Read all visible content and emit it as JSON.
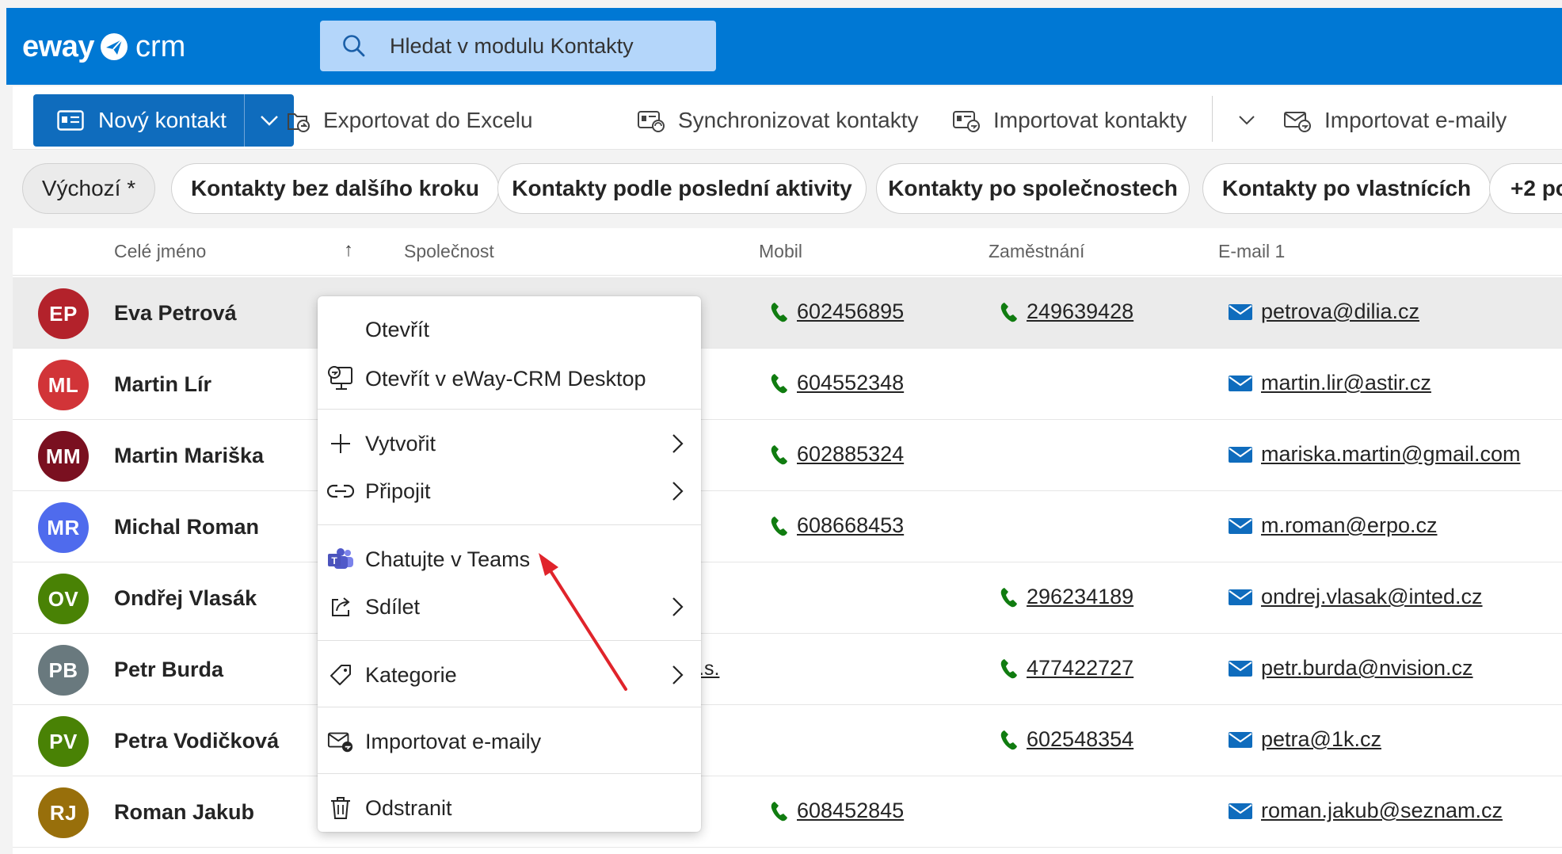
{
  "header": {
    "logo_eway": "eway",
    "logo_crm": "crm",
    "search_placeholder": "Hledat v modulu Kontakty",
    "brand_color": "#0078d4"
  },
  "toolbar": {
    "new_contact_label": "Nový kontakt",
    "export_excel_label": "Exportovat do Excelu",
    "sync_contacts_label": "Synchronizovat kontakty",
    "import_contacts_label": "Importovat kontakty",
    "import_emails_label": "Importovat e-maily"
  },
  "views": [
    {
      "label": "Výchozí *",
      "active": true
    },
    {
      "label": "Kontakty bez dalšího kroku",
      "active": false
    },
    {
      "label": "Kontakty podle poslední aktivity",
      "active": false
    },
    {
      "label": "Kontakty po společnostech",
      "active": false
    },
    {
      "label": "Kontakty po vlastnících",
      "active": false
    },
    {
      "label": "+2 po",
      "active": false
    }
  ],
  "grid": {
    "columns": [
      "Celé jméno",
      "Společnost",
      "Mobil",
      "Zaměstnání",
      "E-mail 1"
    ],
    "sort_indicator": "↑",
    "rows": [
      {
        "initials": "EP",
        "color": "#b3222b",
        "name": "Eva Petrová",
        "mobile": "602456895",
        "work": "249639428",
        "email": "petrova@dilia.cz",
        "selected": true
      },
      {
        "initials": "ML",
        "color": "#d13438",
        "name": "Martin Lír",
        "mobile": "604552348",
        "work": "",
        "email": "martin.lir@astir.cz"
      },
      {
        "initials": "MM",
        "color": "#7a1020",
        "name": "Martin Mariška",
        "mobile": "602885324",
        "work": "",
        "email": "mariska.martin@gmail.com"
      },
      {
        "initials": "MR",
        "color": "#4f6bed",
        "name": "Michal Roman",
        "mobile": "608668453",
        "work": "",
        "email": "m.roman@erpo.cz"
      },
      {
        "initials": "OV",
        "color": "#498205",
        "name": "Ondřej Vlasák",
        "mobile": "",
        "work": "296234189",
        "email": "ondrej.vlasak@inted.cz"
      },
      {
        "initials": "PB",
        "color": "#69797e",
        "name": "Petr Burda",
        "mobile": "",
        "work": "477422727",
        "email": "petr.burda@nvision.cz",
        "company_fragment": ".s."
      },
      {
        "initials": "PV",
        "color": "#498205",
        "name": "Petra Vodičková",
        "mobile": "",
        "work": "602548354",
        "email": "petra@1k.cz"
      },
      {
        "initials": "RJ",
        "color": "#986f0b",
        "name": "Roman Jakub",
        "mobile": "608452845",
        "work": "",
        "email": "roman.jakub@seznam.cz"
      }
    ]
  },
  "context_menu": {
    "open": "Otevřít",
    "open_desktop": "Otevřít v eWay-CRM Desktop",
    "create": "Vytvořit",
    "connect": "Připojit",
    "teams_chat": "Chatujte v Teams",
    "share": "Sdílet",
    "category": "Kategorie",
    "import_emails": "Importovat e-maily",
    "delete": "Odstranit"
  },
  "colors": {
    "phone_icon": "#107c10",
    "mail_icon": "#0f6cbd",
    "annotation_arrow": "#e0242b"
  }
}
